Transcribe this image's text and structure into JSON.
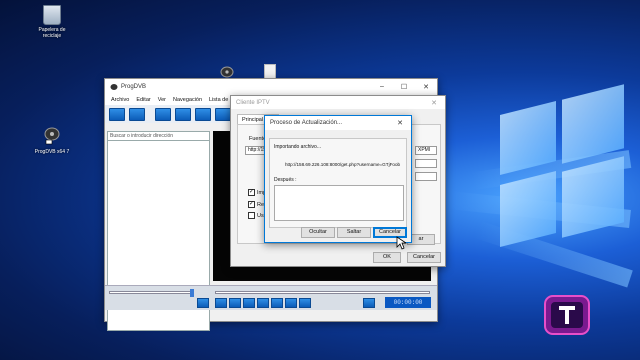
{
  "desktop": {
    "icons": [
      {
        "label": "Papelera de reciclaje"
      },
      {
        "label": "ProgDVB x64 7"
      }
    ]
  },
  "progdvb": {
    "title": "ProgDVB",
    "menu": [
      "Archivo",
      "Editar",
      "Ver",
      "Navegación",
      "Lista de ca"
    ],
    "search_placeholder": "Buscar o introducir dirección",
    "timecode": "00:00:00",
    "window_buttons": {
      "minimize": "–",
      "maximize": "☐",
      "close": "✕"
    }
  },
  "iptv": {
    "title": "Cliente IPTV",
    "tabs": [
      "Principal",
      "D"
    ],
    "source_label": "Fuente",
    "url_value": "http://15",
    "format_value": "XPMI",
    "checkboxes": [
      {
        "label": "Imp",
        "checked": true
      },
      {
        "label": "Rec",
        "checked": true
      },
      {
        "label": "Use",
        "checked": false
      }
    ],
    "ok_label": "OK",
    "cancel_label": "Cancelar",
    "partial_button": "ar"
  },
  "update": {
    "title": "Proceso de Actualización...",
    "importing_label": "Importando archivo...",
    "importing_url": "http://158.69.226.108:8000/get.php?username=GTjFoob",
    "after_label": "Después :",
    "buttons": {
      "hide": "Ocultar",
      "skip": "Saltar",
      "cancel": "Cancelar"
    },
    "close": "✕"
  },
  "colors": {
    "accent": "#0078d7",
    "desktop_blue": "#1c5fd6",
    "toolbar_blue": "#0c5cb8"
  }
}
